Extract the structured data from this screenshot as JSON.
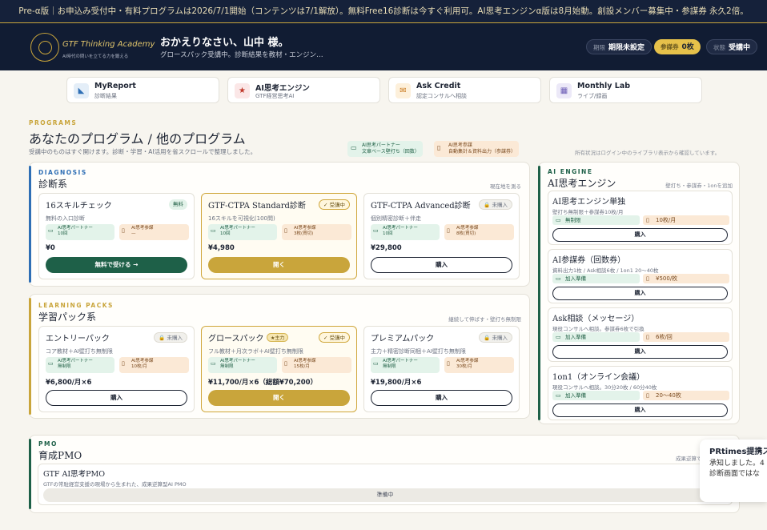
{
  "announcement": "Pre-α版｜お申込み受付中・有料プログラムは2026/7/1開始（コンテンツは7/1解放）。無料Free16診断は今すぐ利用可。AI思考エンジンα版は8月始動。創設メンバー募集中・参謀券 永久2倍。",
  "header": {
    "logo_name": "GTF Thinking Academy",
    "logo_tagline": "AI時代の問いを立てる力を鍛える",
    "greeting": "おかえりなさい、山中 様。",
    "subtitle": "グロースパック受講中。診断結果を教材・エンジン…",
    "pills": [
      {
        "label": "期限",
        "value": "期限未設定"
      },
      {
        "label": "参謀券",
        "value": "0枚"
      },
      {
        "label": "状態",
        "value": "受講中"
      }
    ]
  },
  "nav": [
    {
      "title": "MyReport",
      "sub": "診断結果",
      "icon": "report-icon",
      "icon_glyph": "◣"
    },
    {
      "title": "AI思考エンジン",
      "sub": "GTF経営思考AI",
      "icon": "star-icon",
      "icon_glyph": "★"
    },
    {
      "title": "Ask Credit",
      "sub": "認定コンサルへ相談",
      "icon": "mail-icon",
      "icon_glyph": "✉"
    },
    {
      "title": "Monthly Lab",
      "sub": "ライブ/録画",
      "icon": "calendar-icon",
      "icon_glyph": "▦"
    }
  ],
  "programs": {
    "kicker": "PROGRAMS",
    "title": "あなたのプログラム / 他のプログラム",
    "subtitle": "受講中のものはすぐ開けます。診断・学習・AI活用を省スクロールで整理しました。",
    "legend": [
      {
        "line1": "AI思考パートナー",
        "line2": "文章ベース壁打ち（回数）"
      },
      {
        "line1": "AI思考参謀",
        "line2": "自動集計＆資料出力（参謀券）"
      }
    ],
    "note": "所有状況はログイン中のライブラリ表示から確認しています。"
  },
  "diagnosis": {
    "kicker": "DIAGNOSIS",
    "title": "診断系",
    "right": "現在地を測る",
    "cards": [
      {
        "title": "16スキルチェック",
        "badge": "無料",
        "desc": "無料の入口診断",
        "ta_label": "AI思考パートナー",
        "ta_value": "10回",
        "tb_label": "AI思考参謀",
        "tb_value": "—",
        "price": "¥0",
        "button": "無料で受ける →"
      },
      {
        "title": "GTF-CTPA Standard診断",
        "badge": "✓ 受講中",
        "desc": "16スキルを可視化(100問)",
        "ta_label": "AI思考パートナー",
        "ta_value": "10回",
        "tb_label": "AI思考参謀",
        "tb_value": "3枚(買切)",
        "price": "¥4,980",
        "button": "開く"
      },
      {
        "title": "GTF-CTPA Advanced診断",
        "badge": "🔒 未購入",
        "desc": "個別精密診断＋伴走",
        "ta_label": "AI思考パートナー",
        "ta_value": "10回",
        "tb_label": "AI思考参謀",
        "tb_value": "8枚(買切)",
        "price": "¥29,800",
        "button": "購入"
      }
    ]
  },
  "learning": {
    "kicker": "LEARNING PACKS",
    "title": "学習パック系",
    "right": "継続して伸ばす・壁打ち無制限",
    "cards": [
      {
        "title": "エントリーパック",
        "badge": "🔒 未購入",
        "desc": "コア教材＋AI壁打ち無制限",
        "ta_label": "AI思考パートナー",
        "ta_value": "無制限",
        "tb_label": "AI思考参謀",
        "tb_value": "10枚/月",
        "price": "¥6,800/月×6",
        "button": "購入"
      },
      {
        "title": "グロースパック",
        "star": "★主力",
        "badge": "✓ 受講中",
        "desc": "フル教材＋月次ラボ＋AI壁打ち無制限",
        "ta_label": "AI思考パートナー",
        "ta_value": "無制限",
        "tb_label": "AI思考参謀",
        "tb_value": "15枚/月",
        "price": "¥11,700/月×6（総額¥70,200）",
        "button": "開く"
      },
      {
        "title": "プレミアムパック",
        "badge": "🔒 未購入",
        "desc": "主力＋精密診断同梱＋AI壁打ち無制限",
        "ta_label": "AI思考パートナー",
        "ta_value": "無制限",
        "tb_label": "AI思考参謀",
        "tb_value": "30枚/月",
        "price": "¥19,800/月×6",
        "button": "購入"
      }
    ]
  },
  "engine": {
    "kicker": "AI ENGINE",
    "title": "AI思考エンジン",
    "right": "壁打ち・参謀券・1onを追加",
    "cards": [
      {
        "title": "AI思考エンジン単独",
        "desc": "壁打ち無制限＋参謀券10枚/月",
        "a": "無制限",
        "b": "10枚/月",
        "button": "購入"
      },
      {
        "title": "AI参謀券（回数券）",
        "desc": "資料出力1枚 / Ask相談6枚 / 1on1 20〜40枚",
        "a": "加入準備",
        "b": "¥500/枚",
        "button": "購入"
      },
      {
        "title": "Ask相談（メッセージ）",
        "desc": "現役コンサルへ相談。参謀券6枚で引換",
        "a": "加入準備",
        "b": "6枚/回",
        "button": "購入"
      },
      {
        "title": "1on1（オンライン会議）",
        "desc": "現役コンサルへ相談。30分20枚 / 60分40枚",
        "a": "加入準備",
        "b": "20〜40枚",
        "button": "購入"
      }
    ]
  },
  "pmo": {
    "kicker": "PMO",
    "title": "育成PMO",
    "right": "成果逆算で進",
    "card_title": "GTF AI思考PMO",
    "card_desc": "GTFの常駐経営支援の現場から生まれた、成果逆算型AI PMO",
    "status": "準備中"
  },
  "toast": {
    "title": "PRtimes提携ス",
    "line1": "承知しました。4",
    "line2": "診断画面ではな"
  },
  "colors": {
    "navy": "#111c33",
    "gold": "#c9a53b",
    "green": "#1e6048",
    "blue": "#2f6fb5"
  }
}
